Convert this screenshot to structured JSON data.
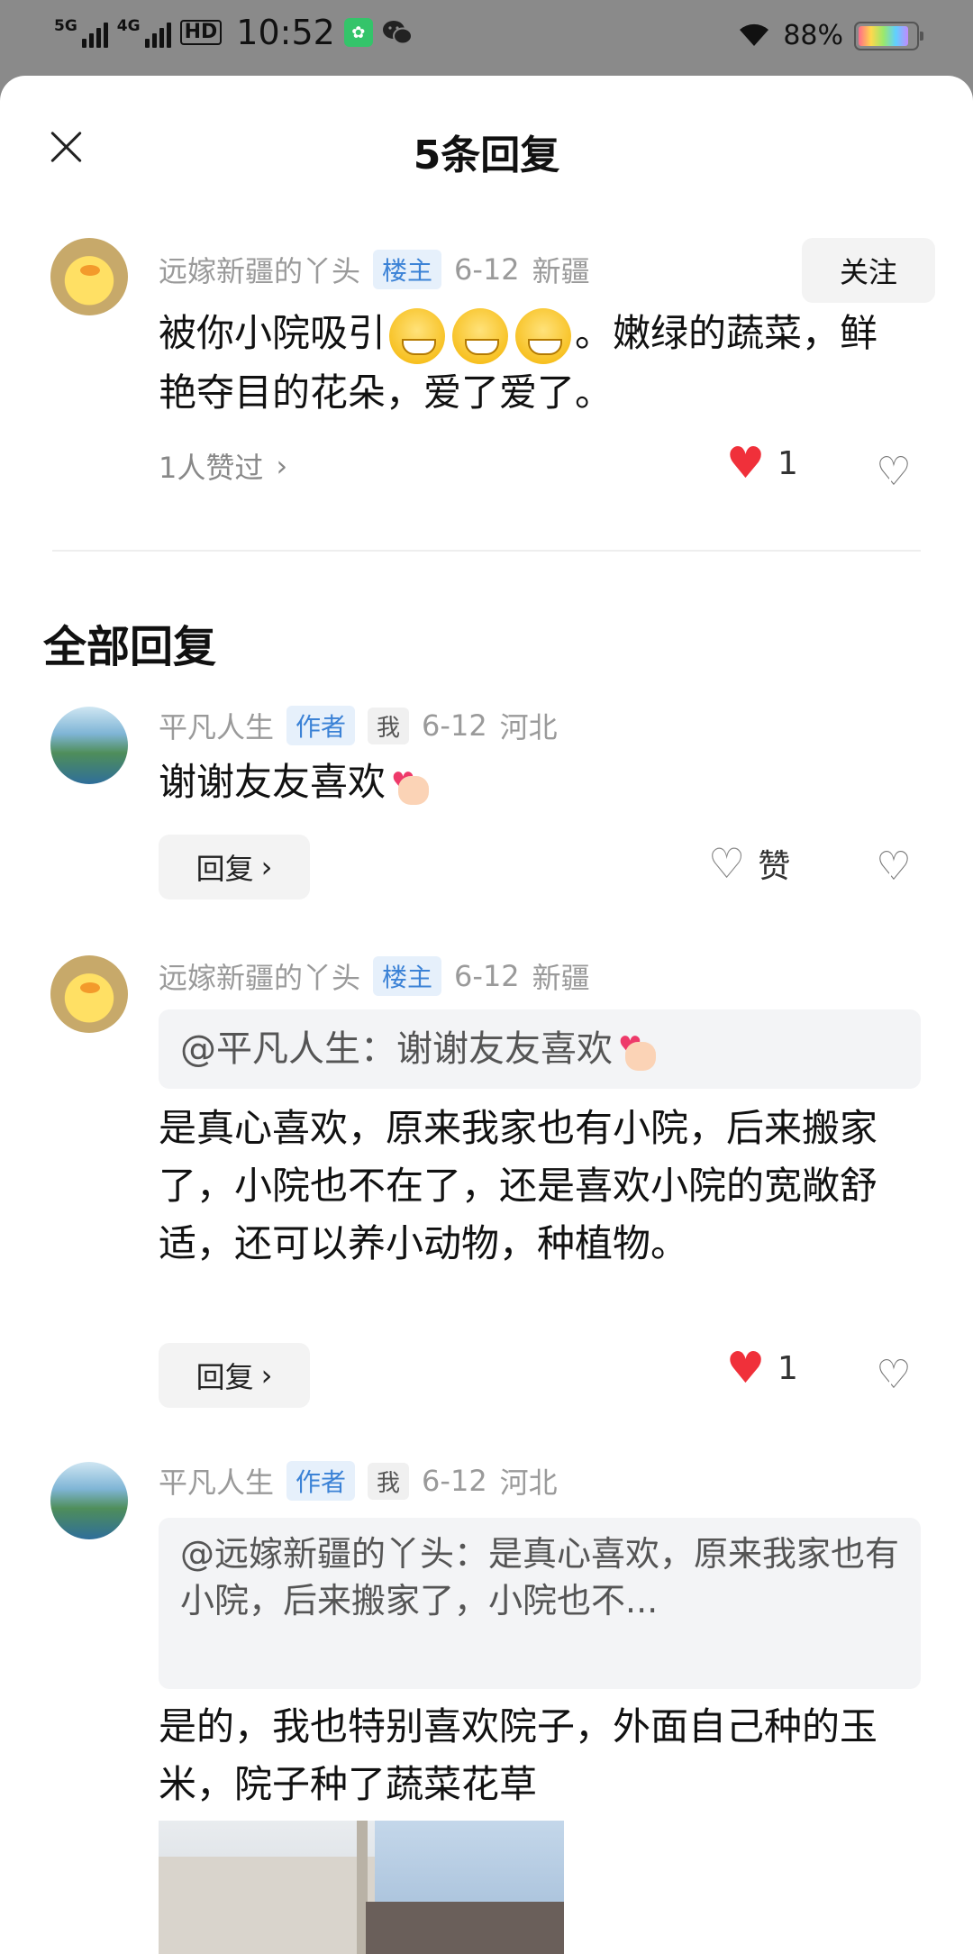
{
  "status_bar": {
    "net1": "5G",
    "net2": "4G",
    "hd": "HD",
    "time": "10:52",
    "battery": "88%",
    "battery_level": 0.88
  },
  "header": {
    "title": "5条回复"
  },
  "main_comment": {
    "user": "远嫁新疆的丫头",
    "tag": "楼主",
    "date": "6-12",
    "location": "新疆",
    "follow_label": "关注",
    "text_before": "被你小院吸引",
    "text_after": "。嫩绿的蔬菜，鲜艳夺目的花朵，爱了爱了。",
    "liked_by": "1人赞过",
    "like_count": "1"
  },
  "section_title": "全部回复",
  "replies": [
    {
      "user": "平凡人生",
      "tag": "作者",
      "me": "我",
      "date": "6-12",
      "location": "河北",
      "text": "谢谢友友喜欢",
      "reply_label": "回复",
      "like_label": "赞"
    },
    {
      "user": "远嫁新疆的丫头",
      "tag": "楼主",
      "date": "6-12",
      "location": "新疆",
      "quote": "@平凡人生：谢谢友友喜欢",
      "text": "是真心喜欢，原来我家也有小院，后来搬家了，小院也不在了，还是喜欢小院的宽敞舒适，还可以养小动物，种植物。",
      "reply_label": "回复",
      "like_count": "1"
    },
    {
      "user": "平凡人生",
      "tag": "作者",
      "me": "我",
      "date": "6-12",
      "location": "河北",
      "quote": "@远嫁新疆的丫头：是真心喜欢，原来我家也有小院，后来搬家了，小院也不...",
      "text": "是的，我也特别喜欢院子，外面自己种的玉米，院子种了蔬菜花草"
    }
  ]
}
